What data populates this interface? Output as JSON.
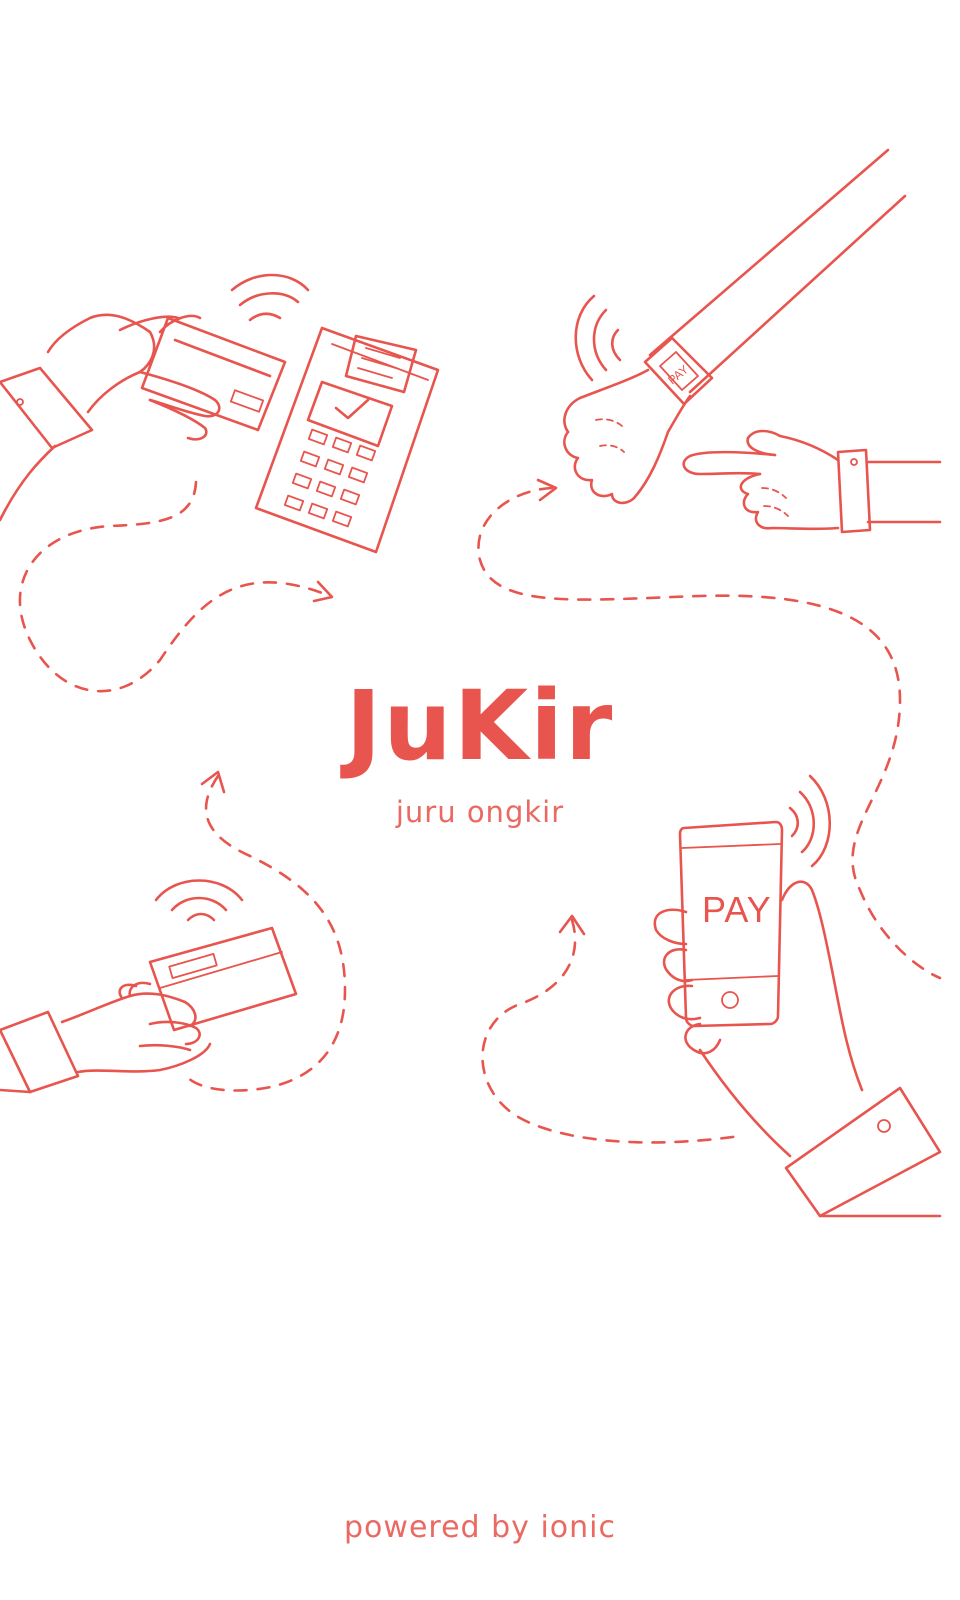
{
  "app": {
    "title": "JuKir",
    "subtitle": "juru ongkir",
    "footer": "powered by ionic"
  },
  "illustration": {
    "phone_screen_label": "PAY",
    "watch_label": "PAY",
    "stroke_color": "#e8554e",
    "icons": [
      "card-terminal-payment",
      "smartwatch-payment",
      "credit-card-contactless",
      "mobile-phone-payment",
      "wireless-signal-icon"
    ]
  },
  "colors": {
    "accent": "#e8554e",
    "background": "#ffffff"
  }
}
